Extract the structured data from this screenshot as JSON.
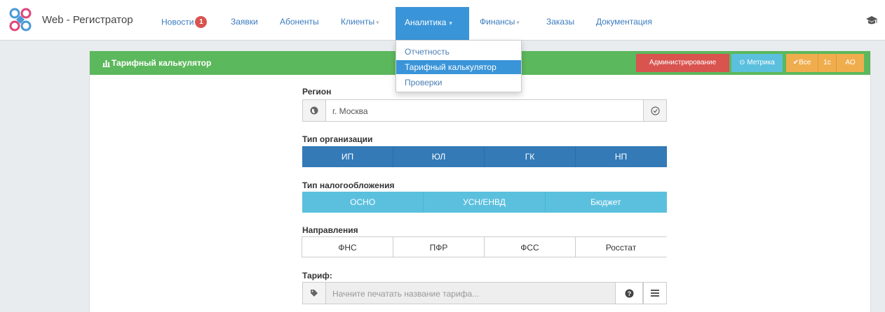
{
  "app": {
    "brand": "Web - Регистратор"
  },
  "nav": {
    "items": [
      {
        "label": "Новости",
        "badge": "1"
      },
      {
        "label": "Заявки"
      },
      {
        "label": "Абоненты"
      },
      {
        "label": "Клиенты"
      },
      {
        "label": "Аналитика",
        "active": true
      },
      {
        "label": "Финансы"
      },
      {
        "label": "Заказы"
      },
      {
        "label": "Документация"
      }
    ]
  },
  "dropdown": {
    "items": [
      {
        "label": "Отчетность"
      },
      {
        "label": "Тарифный калькулятор",
        "active": true
      },
      {
        "label": "Проверки"
      }
    ]
  },
  "panel": {
    "title": "Тарифный калькулятор",
    "buttons": {
      "admin": "Администрирование",
      "metric": "Метрика",
      "all": "Все",
      "onec": "1с",
      "ao": "АО"
    }
  },
  "form": {
    "region": {
      "label": "Регион",
      "value": "г. Москва"
    },
    "org_type": {
      "label": "Тип организации",
      "options": [
        "ИП",
        "ЮЛ",
        "ГК",
        "НП"
      ]
    },
    "tax_type": {
      "label": "Тип налогообложения",
      "options": [
        "ОСНО",
        "УСН/ЕНВД",
        "Бюджет"
      ]
    },
    "directions": {
      "label": "Направления",
      "options": [
        "ФНС",
        "ПФР",
        "ФСС",
        "Росстат"
      ]
    },
    "tariff": {
      "label": "Тариф:",
      "placeholder": "Начните печатать название тарифа..."
    }
  },
  "colors": {
    "header_green": "#5cb85c",
    "nav_active": "#3a94d8",
    "primary": "#337ab7",
    "info": "#5bc0de",
    "danger": "#d9534f",
    "warning": "#f0ad4e",
    "badge": "#d9534f"
  },
  "icons": [
    "logo-icon",
    "graduation-cap-icon",
    "bar-chart-icon",
    "globe-icon",
    "check-circle-icon",
    "tag-icon",
    "question-circle-icon",
    "list-icon",
    "checkmark-icon"
  ]
}
